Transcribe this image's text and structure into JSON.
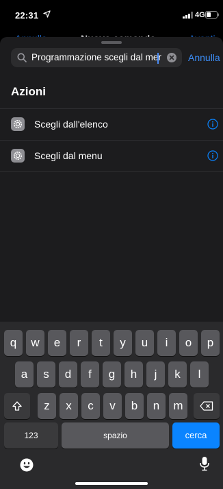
{
  "status_bar": {
    "time": "22:31",
    "network": "4G"
  },
  "behind": {
    "left": "Annulla",
    "center": "Nuovo comando",
    "right": "Avanti"
  },
  "search": {
    "value": "Programmazione scegli dal mer",
    "cancel_label": "Annulla"
  },
  "section": {
    "title": "Azioni"
  },
  "actions": [
    {
      "label": "Scegli dall'elenco",
      "icon": "gear-icon"
    },
    {
      "label": "Scegli dal menu",
      "icon": "gear-icon"
    }
  ],
  "keyboard": {
    "row1": [
      "q",
      "w",
      "e",
      "r",
      "t",
      "y",
      "u",
      "i",
      "o",
      "p"
    ],
    "row2": [
      "a",
      "s",
      "d",
      "f",
      "g",
      "h",
      "j",
      "k",
      "l"
    ],
    "row3": [
      "z",
      "x",
      "c",
      "v",
      "b",
      "n",
      "m"
    ],
    "numbers_label": "123",
    "space_label": "spazio",
    "go_label": "cerca"
  },
  "colors": {
    "accent": "#0a84ff",
    "sheet": "#1c1c1e",
    "key": "#58585c"
  }
}
